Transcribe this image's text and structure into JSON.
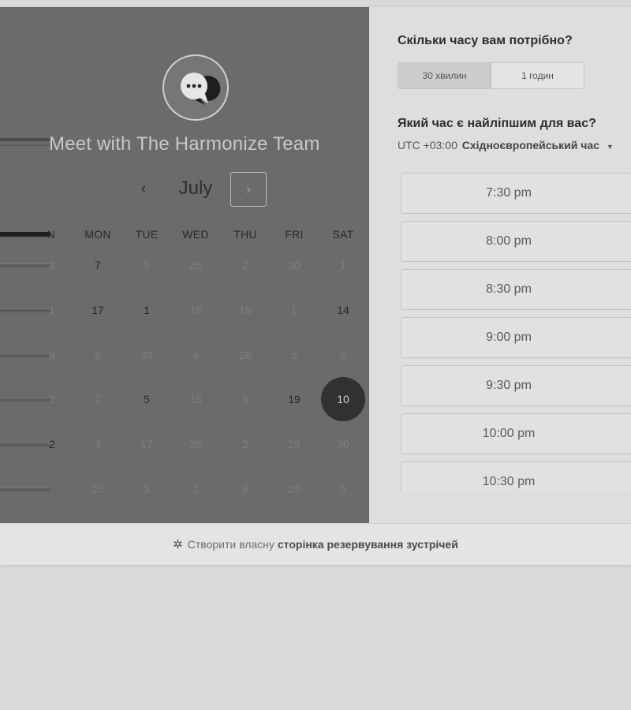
{
  "left": {
    "title": "Meet with The Harmonize Team",
    "month": "July",
    "prev_symbol": "‹",
    "next_symbol": "›",
    "weekdays": [
      "N",
      "MON",
      "TUE",
      "WED",
      "THU",
      "FRI",
      "SAT"
    ],
    "weeks": [
      [
        {
          "d": "4",
          "s": "faded"
        },
        {
          "d": "7",
          "s": "avail"
        },
        {
          "d": "9",
          "s": "faded"
        },
        {
          "d": "26",
          "s": "faded"
        },
        {
          "d": "2",
          "s": "faded"
        },
        {
          "d": "30",
          "s": "faded"
        },
        {
          "d": "1",
          "s": "faded"
        }
      ],
      [
        {
          "d": "1",
          "s": "faded"
        },
        {
          "d": "17",
          "s": "avail"
        },
        {
          "d": "1",
          "s": "avail"
        },
        {
          "d": "18",
          "s": "faded"
        },
        {
          "d": "18",
          "s": "faded"
        },
        {
          "d": "1",
          "s": "faded"
        },
        {
          "d": "14",
          "s": "avail"
        }
      ],
      [
        {
          "d": "8",
          "s": "faded"
        },
        {
          "d": "6",
          "s": "faded"
        },
        {
          "d": "30",
          "s": "faded"
        },
        {
          "d": "4",
          "s": "faded"
        },
        {
          "d": "26",
          "s": "faded"
        },
        {
          "d": "5",
          "s": "faded"
        },
        {
          "d": "9",
          "s": "faded"
        }
      ],
      [
        {
          "d": "2",
          "s": "faded"
        },
        {
          "d": "7",
          "s": "faded"
        },
        {
          "d": "5",
          "s": "avail"
        },
        {
          "d": "18",
          "s": "faded"
        },
        {
          "d": "6",
          "s": "faded"
        },
        {
          "d": "19",
          "s": "avail"
        },
        {
          "d": "10",
          "s": "selected"
        }
      ],
      [
        {
          "d": "2",
          "s": "avail"
        },
        {
          "d": "3",
          "s": "faded"
        },
        {
          "d": "17",
          "s": "faded"
        },
        {
          "d": "25",
          "s": "faded"
        },
        {
          "d": "2",
          "s": "faded"
        },
        {
          "d": "25",
          "s": "faded"
        },
        {
          "d": "30",
          "s": "faded"
        }
      ],
      [
        {
          "d": "",
          "s": "faded"
        },
        {
          "d": "25",
          "s": "faded"
        },
        {
          "d": "3",
          "s": "faded"
        },
        {
          "d": "1",
          "s": "faded"
        },
        {
          "d": "6",
          "s": "faded"
        },
        {
          "d": "25",
          "s": "faded"
        },
        {
          "d": "5",
          "s": "faded"
        }
      ]
    ]
  },
  "right": {
    "duration_question": "Скільки часу вам потрібно?",
    "durations": [
      "30 хвилин",
      "1 годин"
    ],
    "time_question": "Який час є найліпшим для вас?",
    "timezone_offset": "UTC +03:00",
    "timezone_name": "Східноєвропейський час",
    "slots": [
      "7:30 pm",
      "8:00 pm",
      "8:30 pm",
      "9:00 pm",
      "9:30 pm",
      "10:00 pm",
      "10:30 pm"
    ]
  },
  "footer": {
    "text": "Створити власну",
    "link": "сторінка резервування зустрічей"
  },
  "colors": {
    "left_panel_bg": "#6b6b6b",
    "selected_day_bg": "#313131",
    "right_panel_bg": "#dedede"
  }
}
